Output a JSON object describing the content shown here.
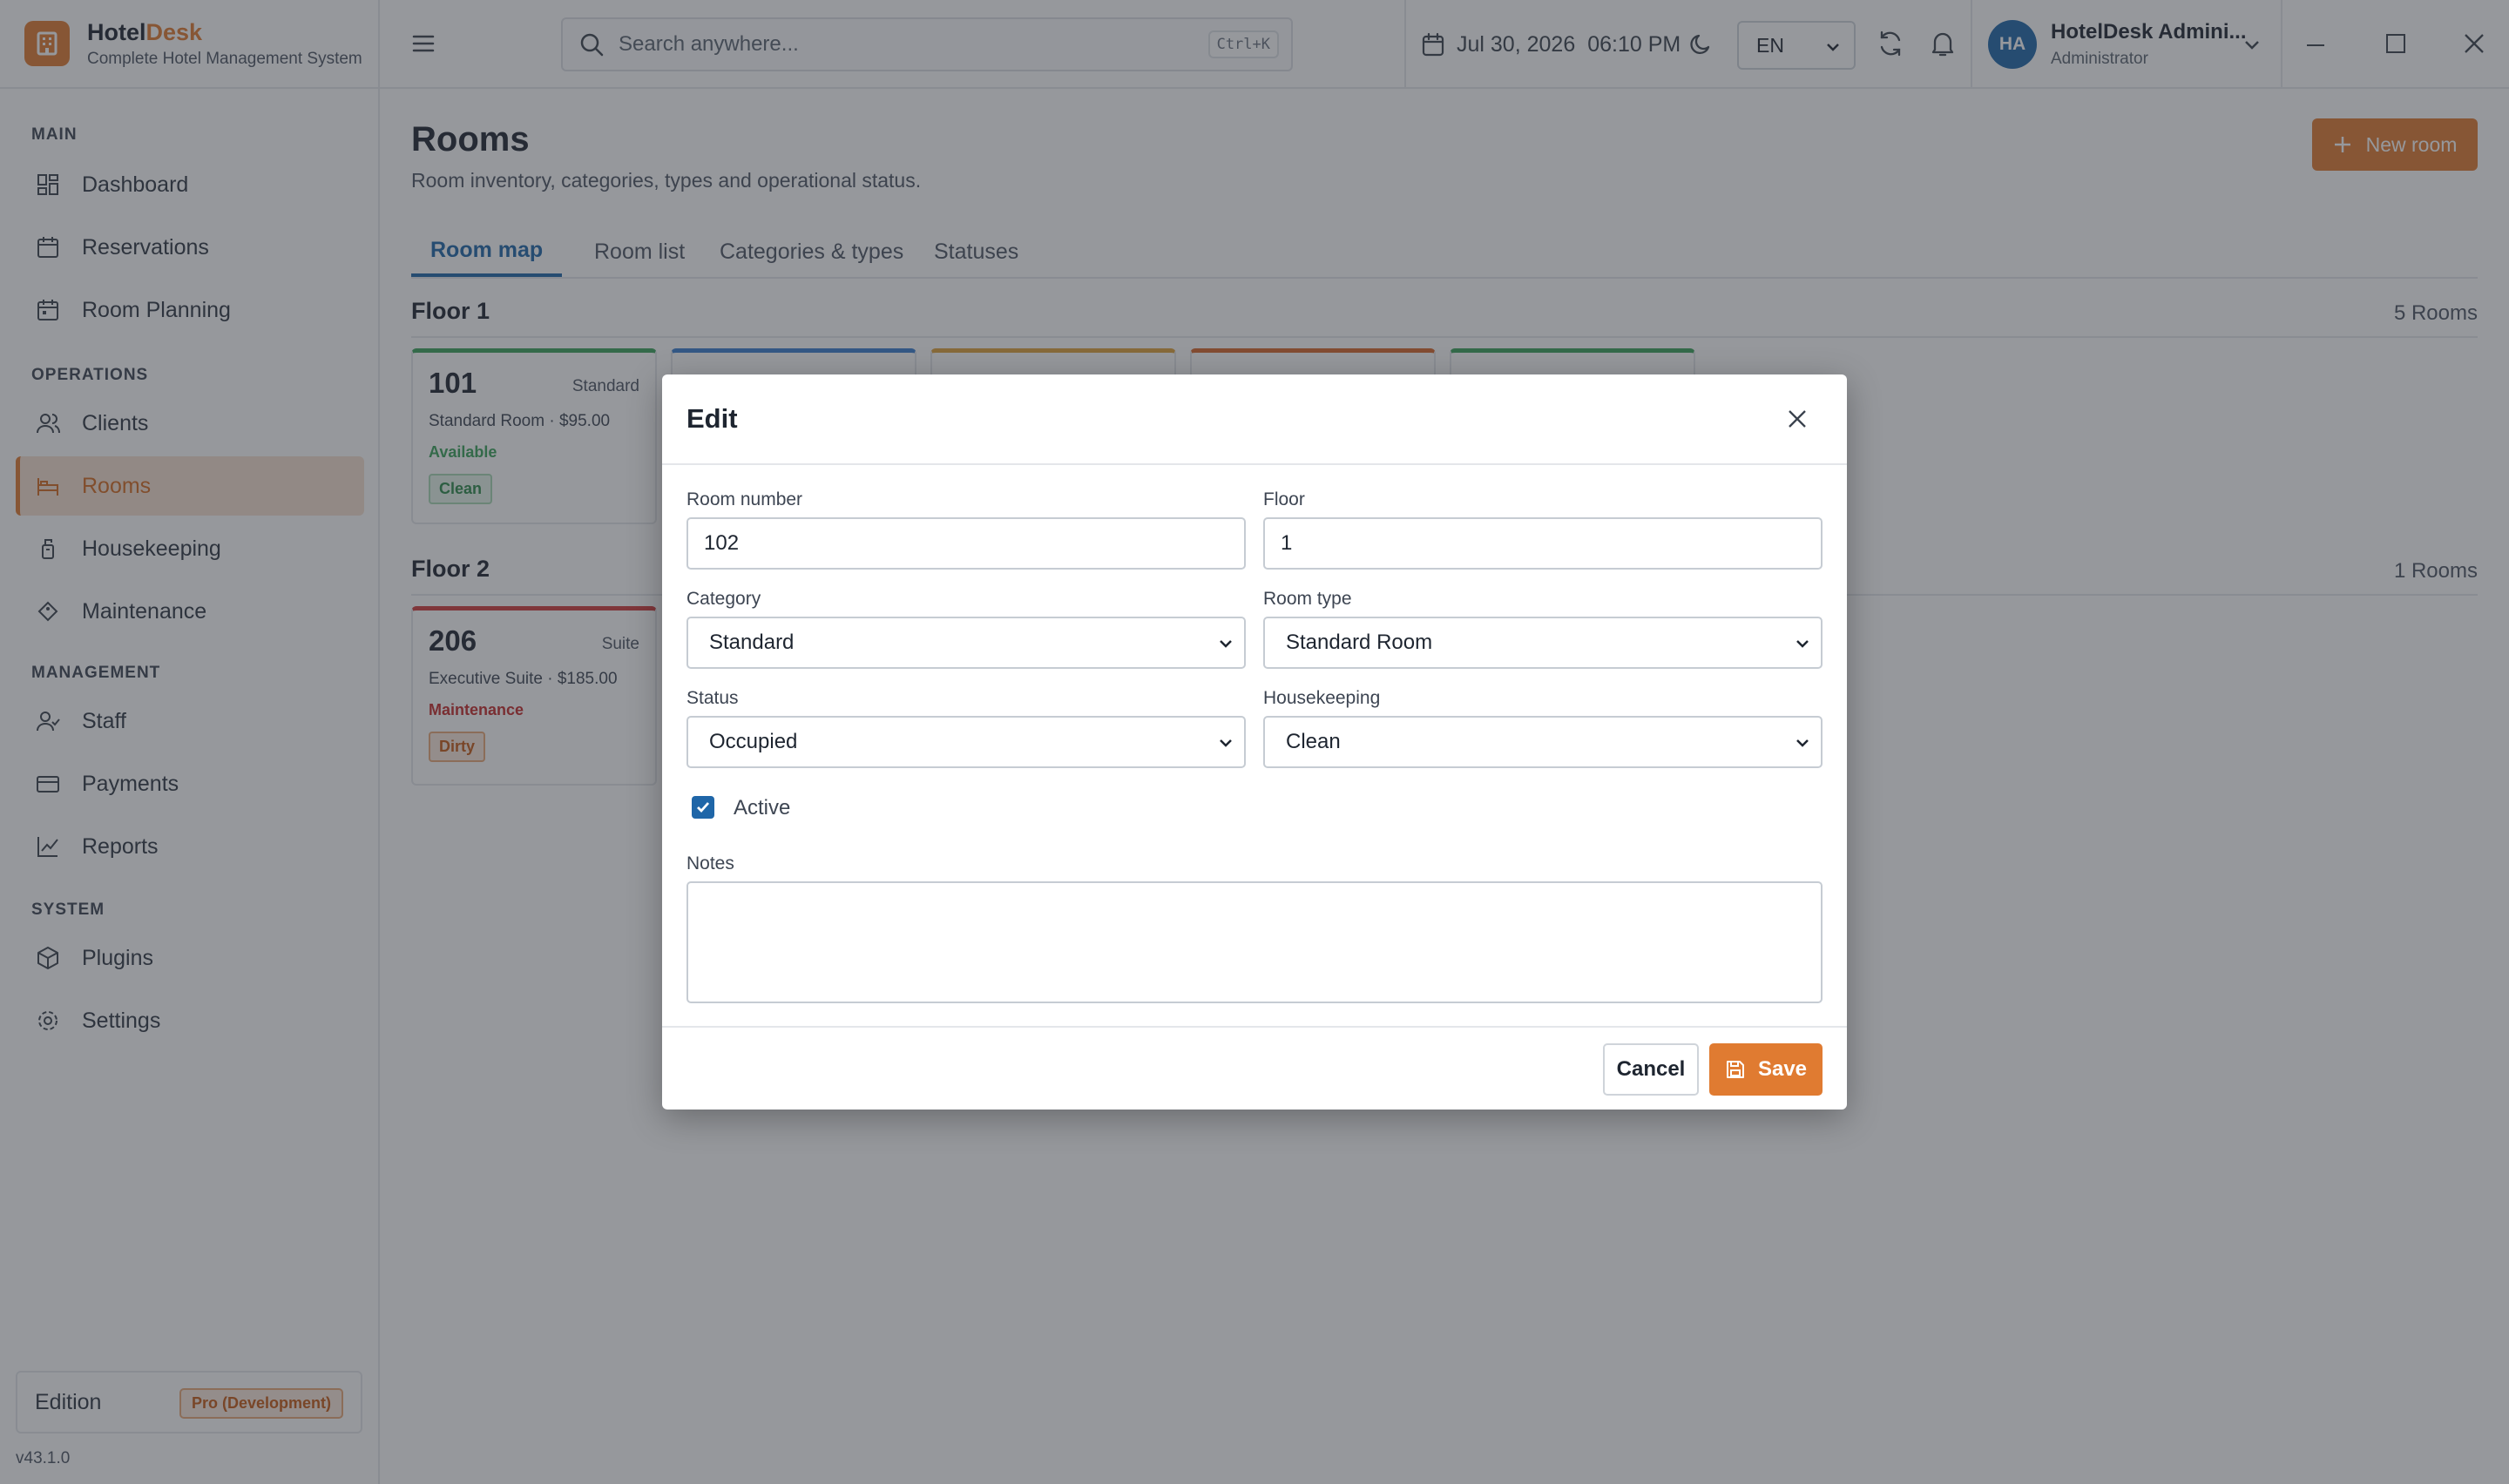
{
  "brand": {
    "name_part1": "Hotel",
    "name_part2": "Desk",
    "subtitle": "Complete Hotel Management System"
  },
  "search": {
    "placeholder": "Search anywhere...",
    "shortcut": "Ctrl+K"
  },
  "header": {
    "date": "Jul 30, 2026",
    "time": "06:10 PM",
    "language": "EN"
  },
  "user": {
    "initials": "HA",
    "name": "HotelDesk Admini...",
    "role": "Administrator"
  },
  "sidebar": {
    "sections": {
      "main": "MAIN",
      "operations": "OPERATIONS",
      "management": "MANAGEMENT",
      "system": "SYSTEM"
    },
    "items": [
      {
        "label": "Dashboard",
        "icon": "dashboard-icon"
      },
      {
        "label": "Reservations",
        "icon": "calendar-icon"
      },
      {
        "label": "Room Planning",
        "icon": "calendar-grid-icon"
      },
      {
        "label": "Clients",
        "icon": "users-icon"
      },
      {
        "label": "Rooms",
        "icon": "bed-icon"
      },
      {
        "label": "Housekeeping",
        "icon": "housekeeping-icon"
      },
      {
        "label": "Maintenance",
        "icon": "wrench-icon"
      },
      {
        "label": "Staff",
        "icon": "staff-icon"
      },
      {
        "label": "Payments",
        "icon": "credit-card-icon"
      },
      {
        "label": "Reports",
        "icon": "chart-icon"
      },
      {
        "label": "Plugins",
        "icon": "package-icon"
      },
      {
        "label": "Settings",
        "icon": "gear-icon"
      }
    ],
    "active": "Rooms",
    "edition_label": "Edition",
    "edition_value": "Pro (Development)",
    "version": "v43.1.0"
  },
  "page": {
    "title": "Rooms",
    "subtitle": "Room inventory, categories, types and operational status.",
    "new_button": "New room",
    "tabs": [
      "Room map",
      "Room list",
      "Categories & types",
      "Statuses"
    ],
    "active_tab": "Room map"
  },
  "floors": [
    {
      "name": "Floor 1",
      "count": "5 Rooms",
      "rooms": [
        {
          "number": "101",
          "type": "Standard",
          "desc": "Standard Room · $95.00",
          "status": "Available",
          "badge": "Clean",
          "accent": "#3aa35a"
        }
      ],
      "partial_card_colors": [
        "#3b7fd0",
        "#e0a23a",
        "#d8672a",
        "#3aa35a"
      ]
    },
    {
      "name": "Floor 2",
      "count": "1 Rooms",
      "rooms": [
        {
          "number": "206",
          "type": "Suite",
          "desc": "Executive Suite · $185.00",
          "status": "Maintenance",
          "badge": "Dirty",
          "accent": "#d03a3a"
        }
      ]
    }
  ],
  "modal": {
    "title": "Edit",
    "fields": {
      "room_number": {
        "label": "Room number",
        "value": "102"
      },
      "floor": {
        "label": "Floor",
        "value": "1"
      },
      "category": {
        "label": "Category",
        "value": "Standard"
      },
      "room_type": {
        "label": "Room type",
        "value": "Standard Room"
      },
      "status": {
        "label": "Status",
        "value": "Occupied"
      },
      "housekeeping": {
        "label": "Housekeeping",
        "value": "Clean"
      },
      "active": {
        "label": "Active",
        "checked": true
      },
      "notes": {
        "label": "Notes",
        "value": ""
      }
    },
    "cancel": "Cancel",
    "save": "Save"
  },
  "colors": {
    "accent": "#e07b31",
    "primary": "#1f66a8",
    "available": "#3aa35a",
    "maintenance": "#d03a3a"
  }
}
